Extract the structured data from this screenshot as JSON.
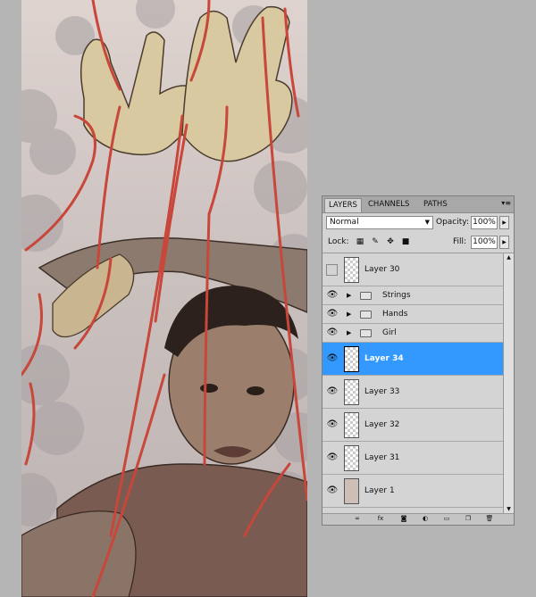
{
  "canvas": {
    "name": "puppet-artwork"
  },
  "panel": {
    "tabs": [
      {
        "label": "LAYERS",
        "active": true
      },
      {
        "label": "CHANNELS",
        "active": false
      },
      {
        "label": "PATHS",
        "active": false
      }
    ],
    "menu_icon": "panel-menu-icon",
    "blend_mode": "Normal",
    "opacity_label": "Opacity:",
    "opacity": "100%",
    "lock_label": "Lock:",
    "fill_label": "Fill:",
    "fill": "100%",
    "lock_icons": [
      "lock-transparent-icon",
      "lock-paint-icon",
      "lock-move-icon",
      "lock-all-icon"
    ],
    "footer_icons": [
      "link-icon",
      "fx-icon",
      "mask-icon",
      "adjustment-icon",
      "new-group-icon",
      "new-layer-icon",
      "trash-icon"
    ]
  },
  "layers": [
    {
      "name": "Layer 30",
      "type": "layer",
      "visible": false,
      "selected": false
    },
    {
      "name": "Strings",
      "type": "group",
      "visible": true,
      "selected": false
    },
    {
      "name": "Hands",
      "type": "group",
      "visible": true,
      "selected": false
    },
    {
      "name": "Girl",
      "type": "group",
      "visible": true,
      "selected": false
    },
    {
      "name": "Layer 34",
      "type": "layer",
      "visible": true,
      "selected": true
    },
    {
      "name": "Layer 33",
      "type": "layer",
      "visible": true,
      "selected": false
    },
    {
      "name": "Layer 32",
      "type": "layer",
      "visible": true,
      "selected": false
    },
    {
      "name": "Layer 31",
      "type": "layer",
      "visible": true,
      "selected": false
    },
    {
      "name": "Layer 1",
      "type": "layer",
      "visible": true,
      "selected": false,
      "thumb": "beige"
    }
  ],
  "colors": {
    "selection": "#3399ff",
    "string": "#c8463a"
  }
}
